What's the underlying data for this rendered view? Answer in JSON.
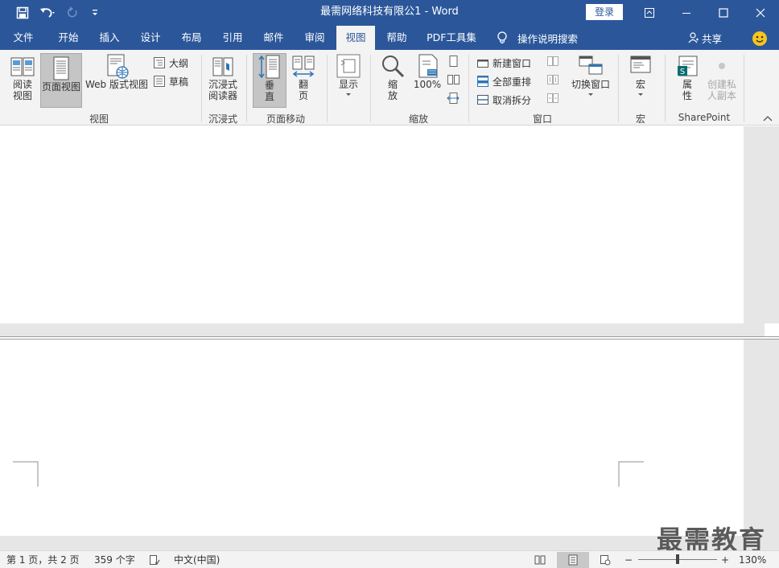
{
  "title_bar": {
    "title": "最需网络科技有限公1  -  Word",
    "login": "登录",
    "bg_color": "#2b579a"
  },
  "tabs": [
    {
      "label": "文件"
    },
    {
      "label": "开始"
    },
    {
      "label": "插入"
    },
    {
      "label": "设计"
    },
    {
      "label": "布局"
    },
    {
      "label": "引用"
    },
    {
      "label": "邮件"
    },
    {
      "label": "审阅"
    },
    {
      "label": "视图",
      "active": true
    },
    {
      "label": "帮助"
    },
    {
      "label": "PDF工具集"
    }
  ],
  "tell_me": "操作说明搜索",
  "share": "共享",
  "ribbon": {
    "views": {
      "read_mode": "阅读\n视图",
      "read_mode_l1": "阅读",
      "read_mode_l2": "视图",
      "print_layout": "页面视图",
      "web_layout": "Web 版式视图",
      "outline": "大纲",
      "draft": "草稿",
      "group": "视图"
    },
    "immersive": {
      "reader_l1": "沉浸式",
      "reader_l2": "阅读器",
      "group": "沉浸式"
    },
    "page_movement": {
      "vertical_l1": "垂",
      "vertical_l2": "直",
      "side_l1": "翻",
      "side_l2": "页",
      "group": "页面移动"
    },
    "show": {
      "label": "显示"
    },
    "zoom": {
      "zoom_l1": "缩",
      "zoom_l2": "放",
      "hundred": "100%",
      "group": "缩放"
    },
    "window": {
      "new_window": "新建窗口",
      "arrange_all": "全部重排",
      "remove_split": "取消拆分",
      "switch_windows": "切换窗口",
      "group": "窗口"
    },
    "macros": {
      "label": "宏",
      "group": "宏"
    },
    "sharepoint": {
      "properties_l1": "属",
      "properties_l2": "性",
      "private_copy_l1": "创建私",
      "private_copy_l2": "人副本",
      "group": "SharePoint"
    }
  },
  "watermark": "最需教育",
  "status_bar": {
    "page": "第 1 页，共 2 页",
    "words": "359 个字",
    "language": "中文(中国)",
    "zoom_percent": "130%",
    "zoom_fraction": 0.5
  }
}
